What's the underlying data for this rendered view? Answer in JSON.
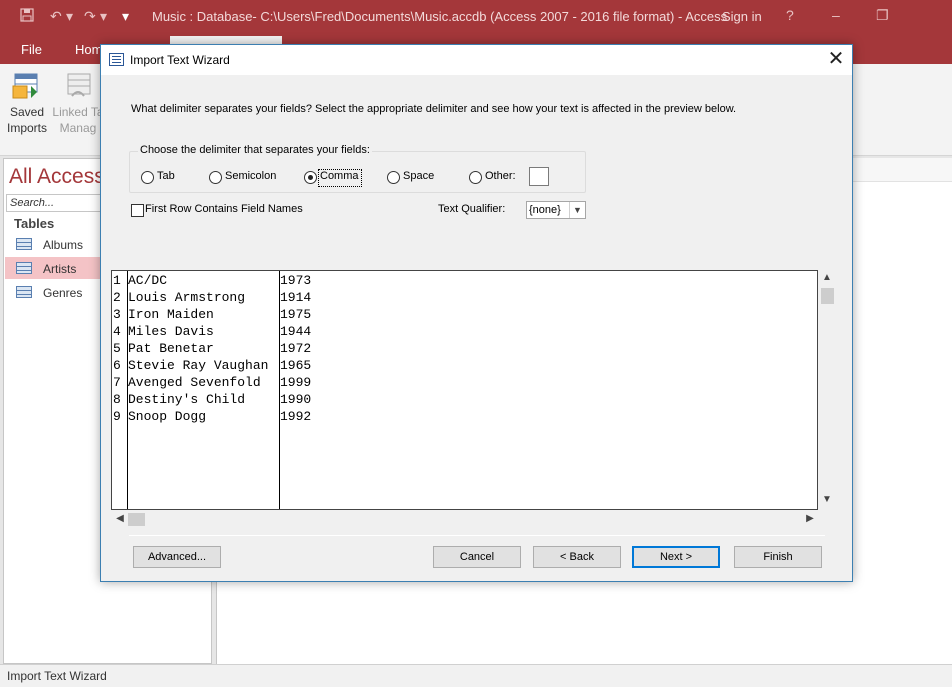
{
  "app": {
    "window_title": "Music : Database- C:\\Users\\Fred\\Documents\\Music.accdb (Access 2007 - 2016 file format) - Access",
    "signin": "Sign in",
    "qat": {
      "save_icon": "save-icon",
      "undo_icon": "undo-icon",
      "redo_icon": "redo-icon",
      "customize_icon": "qat-dropdown-icon"
    },
    "window_buttons": {
      "help": "?",
      "minimize": "–",
      "restore": "❐"
    }
  },
  "ribbon": {
    "tabs": [
      {
        "label": "File"
      },
      {
        "label": "Hom"
      }
    ],
    "items": [
      {
        "line1": "Saved",
        "line2": "Imports"
      },
      {
        "line1": "Linked Ta",
        "line2": "Manag"
      }
    ],
    "collapse": "^"
  },
  "nav": {
    "title": "All Access",
    "search_placeholder": "Search...",
    "group": "Tables",
    "items": [
      {
        "label": "Albums"
      },
      {
        "label": "Artists"
      },
      {
        "label": "Genres"
      }
    ]
  },
  "status": {
    "text": "Import Text Wizard"
  },
  "dialog": {
    "title": "Import Text Wizard",
    "close": "✕",
    "instruction": "What delimiter separates your fields? Select the appropriate delimiter and see how your text is affected in the preview below.",
    "delimiter_group_label": "Choose the delimiter that separates your fields:",
    "delimiters": [
      {
        "label": "Tab",
        "selected": false
      },
      {
        "label": "Semicolon",
        "selected": false
      },
      {
        "label": "Comma",
        "selected": true
      },
      {
        "label": "Space",
        "selected": false
      },
      {
        "label": "Other:",
        "selected": false
      }
    ],
    "other_value": "",
    "first_row_label": "First Row Contains Field Names",
    "first_row_checked": false,
    "text_qualifier_label": "Text Qualifier:",
    "text_qualifier_value": "{none}",
    "preview": {
      "rows": [
        {
          "num": "1",
          "name": "AC/DC",
          "year": "1973"
        },
        {
          "num": "2",
          "name": "Louis Armstrong",
          "year": "1914"
        },
        {
          "num": "3",
          "name": "Iron Maiden",
          "year": "1975"
        },
        {
          "num": "4",
          "name": "Miles Davis",
          "year": "1944"
        },
        {
          "num": "5",
          "name": "Pat Benetar",
          "year": "1972"
        },
        {
          "num": "6",
          "name": "Stevie Ray Vaughan",
          "year": "1965"
        },
        {
          "num": "7",
          "name": "Avenged Sevenfold",
          "year": "1999"
        },
        {
          "num": "8",
          "name": "Destiny's Child",
          "year": "1990"
        },
        {
          "num": "9",
          "name": "Snoop Dogg",
          "year": "1992"
        }
      ]
    },
    "buttons": {
      "advanced": "Advanced...",
      "cancel": "Cancel",
      "back": "< Back",
      "next": "Next >",
      "finish": "Finish"
    }
  }
}
